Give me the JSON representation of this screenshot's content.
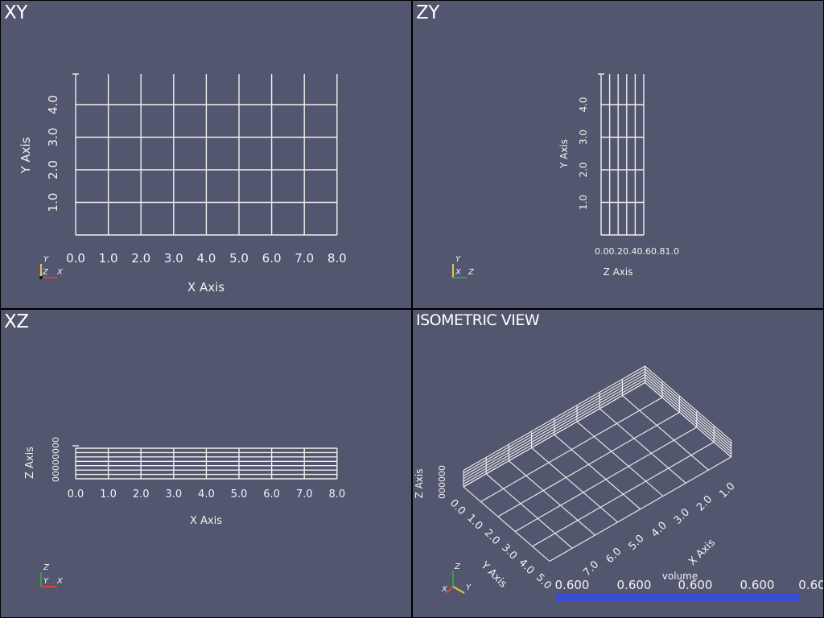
{
  "viewports": {
    "xy": {
      "title": "XY",
      "x_axis_label": "X Axis",
      "y_axis_label": "Y Axis",
      "x_ticks": [
        "0.0",
        "1.0",
        "2.0",
        "3.0",
        "4.0",
        "5.0",
        "6.0",
        "7.0",
        "8.0"
      ],
      "y_ticks": [
        "1.0",
        "2.0",
        "3.0",
        "4.0"
      ],
      "triad": {
        "up": "Y",
        "depth": "Z",
        "right": "X"
      }
    },
    "zy": {
      "title": "ZY",
      "z_axis_label": "Z Axis",
      "y_axis_label": "Y Axis",
      "z_ticks_compressed": "0.00.20.40.60.81.0",
      "y_ticks": [
        "1.0",
        "2.0",
        "3.0",
        "4.0"
      ],
      "triad": {
        "up": "Y",
        "depth": "X",
        "right": "Z"
      }
    },
    "xz": {
      "title": "XZ",
      "x_axis_label": "X Axis",
      "z_axis_label": "Z Axis",
      "x_ticks": [
        "0.0",
        "1.0",
        "2.0",
        "3.0",
        "4.0",
        "5.0",
        "6.0",
        "7.0",
        "8.0"
      ],
      "z_ticks_compressed": "00000000",
      "triad": {
        "up": "Z",
        "depth": "Y",
        "right": "X"
      }
    },
    "iso": {
      "title": "ISOMETRIC VIEW",
      "x_axis_label": "X Axis",
      "y_axis_label": "Y Axis",
      "z_axis_label": "Z Axis",
      "x_ticks": [
        "1.0",
        "2.0",
        "3.0",
        "4.0",
        "5.0",
        "6.0",
        "7.0"
      ],
      "y_ticks": [
        "0.0",
        "1.0",
        "2.0",
        "3.0",
        "4.0",
        "5.0"
      ],
      "z_ticks_compressed": "000000",
      "triad": {
        "x": "X",
        "y": "Y",
        "z": "Z"
      },
      "scalar_bar": {
        "title": "volume",
        "labels": [
          "0.600",
          "0.600",
          "0.600",
          "0.600",
          "0.60"
        ],
        "color": "#3a4dd1"
      }
    }
  },
  "colors": {
    "background": "#52566e",
    "grid": "#f0f0f0",
    "text": "#f2f2f2",
    "border": "#000000"
  }
}
